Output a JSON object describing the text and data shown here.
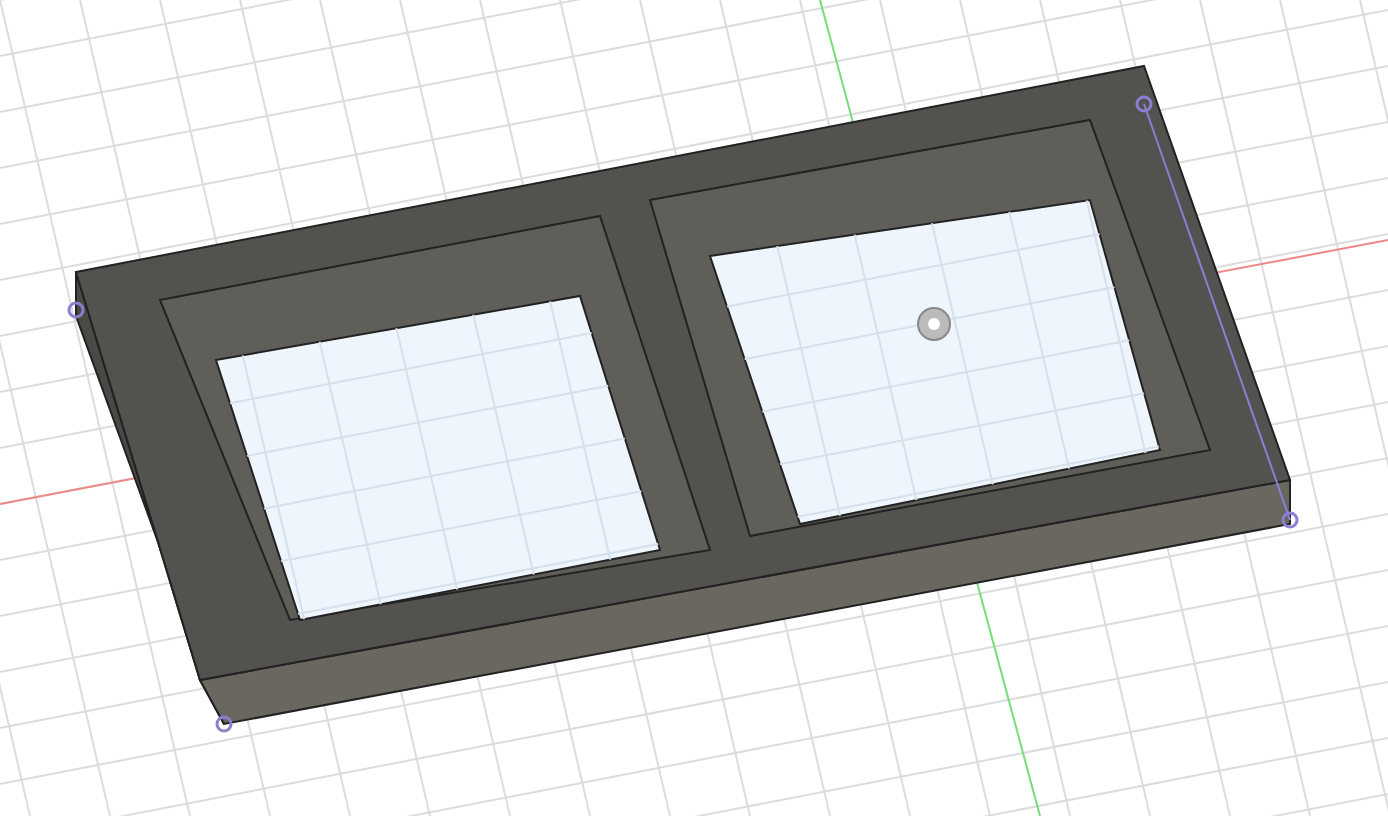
{
  "viewport": {
    "kind": "cad-3d-view"
  }
}
